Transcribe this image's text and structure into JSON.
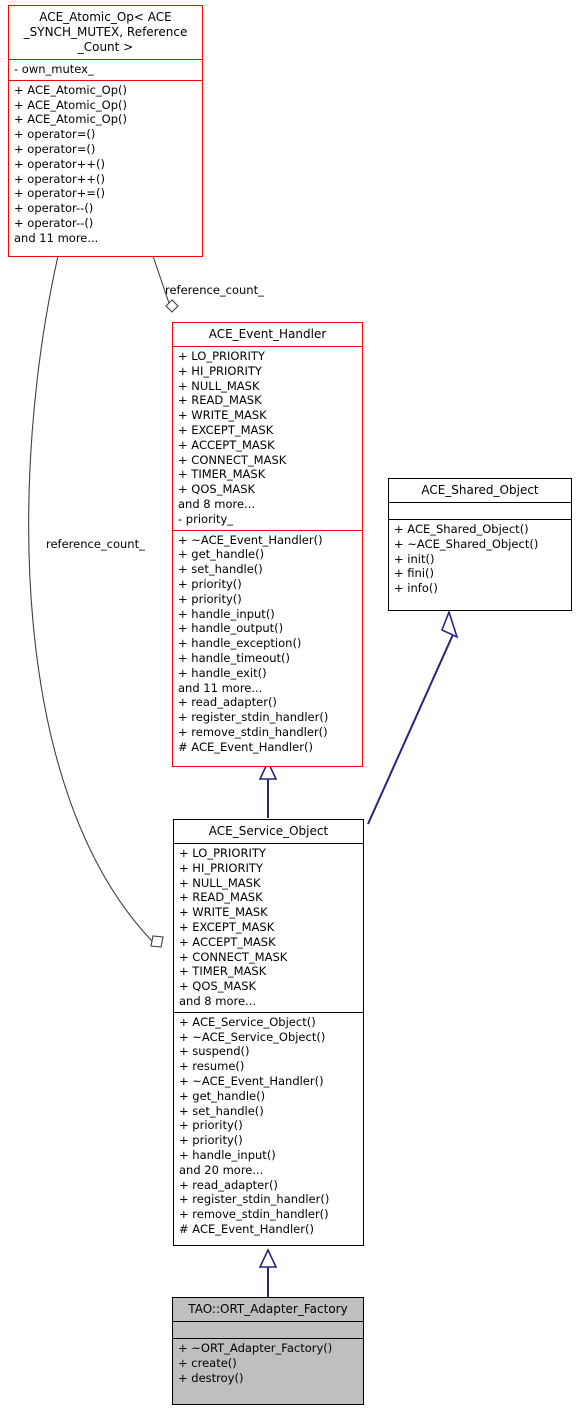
{
  "diagram": {
    "kind": "uml-class-diagram",
    "colors": {
      "red_border": "#ff0000",
      "black_border": "#000000",
      "inherit_arrow": "#26267f",
      "aggregate_line": "#404040",
      "highlight_fill": "#bfbfbf",
      "background": "#ffffff"
    },
    "classes": {
      "ace_atomic_op": {
        "title": [
          "ACE_Atomic_Op< ACE",
          "_SYNCH_MUTEX, Reference",
          "_Count >"
        ],
        "attributes": [
          "- own_mutex_"
        ],
        "operations": [
          "+ ACE_Atomic_Op()",
          "+ ACE_Atomic_Op()",
          "+ ACE_Atomic_Op()",
          "+ operator=()",
          "+ operator=()",
          "+ operator++()",
          "+ operator++()",
          "+ operator+=()",
          "+ operator--()",
          "+ operator--()",
          "and 11 more..."
        ]
      },
      "ace_event_handler": {
        "title": [
          "ACE_Event_Handler"
        ],
        "attributes": [
          "+ LO_PRIORITY",
          "+ HI_PRIORITY",
          "+ NULL_MASK",
          "+ READ_MASK",
          "+ WRITE_MASK",
          "+ EXCEPT_MASK",
          "+ ACCEPT_MASK",
          "+ CONNECT_MASK",
          "+ TIMER_MASK",
          "+ QOS_MASK",
          "and 8 more...",
          "- priority_"
        ],
        "operations": [
          "+ ~ACE_Event_Handler()",
          "+ get_handle()",
          "+ set_handle()",
          "+ priority()",
          "+ priority()",
          "+ handle_input()",
          "+ handle_output()",
          "+ handle_exception()",
          "+ handle_timeout()",
          "+ handle_exit()",
          "and 11 more...",
          "+ read_adapter()",
          "+ register_stdin_handler()",
          "+ remove_stdin_handler()",
          "# ACE_Event_Handler()"
        ]
      },
      "ace_shared_object": {
        "title": [
          "ACE_Shared_Object"
        ],
        "attributes": [],
        "operations": [
          "+ ACE_Shared_Object()",
          "+ ~ACE_Shared_Object()",
          "+ init()",
          "+ fini()",
          "+ info()"
        ]
      },
      "ace_service_object": {
        "title": [
          "ACE_Service_Object"
        ],
        "attributes": [
          "+ LO_PRIORITY",
          "+ HI_PRIORITY",
          "+ NULL_MASK",
          "+ READ_MASK",
          "+ WRITE_MASK",
          "+ EXCEPT_MASK",
          "+ ACCEPT_MASK",
          "+ CONNECT_MASK",
          "+ TIMER_MASK",
          "+ QOS_MASK",
          "and 8 more..."
        ],
        "operations": [
          "+ ACE_Service_Object()",
          "+ ~ACE_Service_Object()",
          "+ suspend()",
          "+ resume()",
          "+ ~ACE_Event_Handler()",
          "+ get_handle()",
          "+ set_handle()",
          "+ priority()",
          "+ priority()",
          "+ handle_input()",
          "and 20 more...",
          "+ read_adapter()",
          "+ register_stdin_handler()",
          "+ remove_stdin_handler()",
          "# ACE_Event_Handler()"
        ]
      },
      "ort_adapter_factory": {
        "title": [
          "TAO::ORT_Adapter_Factory"
        ],
        "attributes": [],
        "operations": [
          "+ ~ORT_Adapter_Factory()",
          "+ create()",
          "+ destroy()"
        ]
      }
    },
    "edge_labels": {
      "to_event_handler": "reference_count_",
      "to_service_object": "reference_count_"
    }
  }
}
